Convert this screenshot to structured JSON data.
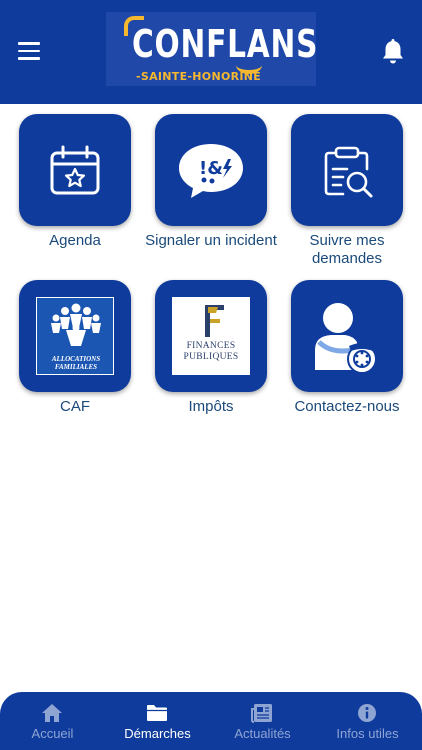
{
  "header": {
    "logo_word": "CONFLANS",
    "logo_sub": "-SAINTE-HONORINE",
    "menu_icon": "hamburger-menu-icon",
    "notification_icon": "bell-icon",
    "background": "#0f3c9c"
  },
  "tiles": [
    {
      "label": "Agenda",
      "icon": "calendar-star-icon"
    },
    {
      "label": "Signaler un incident",
      "icon": "speech-bubble-alert-icon"
    },
    {
      "label": "Suivre mes demandes",
      "icon": "clipboard-search-icon"
    },
    {
      "label": "CAF",
      "icon": "caf-logo",
      "logo_lines": [
        "ALLOCATIONS",
        "FAMILIALES"
      ]
    },
    {
      "label": "Impôts",
      "icon": "finances-publiques-logo",
      "logo_lines": [
        "FINANCES",
        "PUBLIQUES"
      ]
    },
    {
      "label": "Contactez-nous",
      "icon": "person-phone-icon"
    }
  ],
  "tabbar": {
    "items": [
      {
        "label": "Accueil",
        "icon": "home-icon",
        "active": false
      },
      {
        "label": "Démarches",
        "icon": "folder-icon",
        "active": true
      },
      {
        "label": "Actualités",
        "icon": "newspaper-icon",
        "active": false
      },
      {
        "label": "Infos utiles",
        "icon": "info-icon",
        "active": false
      }
    ],
    "active_color": "#ffffff",
    "inactive_color": "#8ea4d3"
  },
  "colors": {
    "brand_blue": "#0f3c9c",
    "accent_yellow": "#f5b82e",
    "label_text": "#1b4a7a"
  }
}
